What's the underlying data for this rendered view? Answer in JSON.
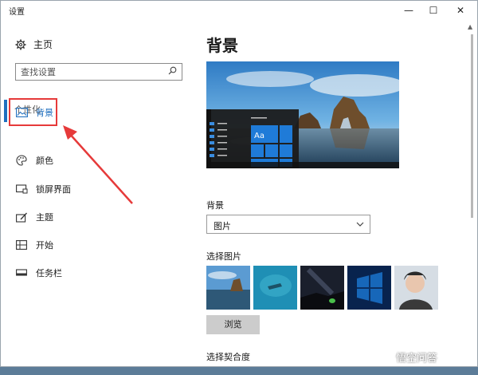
{
  "window": {
    "title": "设置"
  },
  "titlebar_buttons": {
    "minimize": "—",
    "maximize": "☐",
    "close": "✕"
  },
  "sidebar": {
    "home_label": "主页",
    "search_placeholder": "查找设置",
    "section_title": "个性化",
    "items": [
      {
        "label": "背景",
        "icon": "picture-icon",
        "active": true
      },
      {
        "label": "颜色",
        "icon": "palette-icon",
        "active": false
      },
      {
        "label": "锁屏界面",
        "icon": "lock-screen-icon",
        "active": false
      },
      {
        "label": "主题",
        "icon": "theme-icon",
        "active": false
      },
      {
        "label": "开始",
        "icon": "start-icon",
        "active": false
      },
      {
        "label": "任务栏",
        "icon": "taskbar-icon",
        "active": false
      }
    ]
  },
  "main": {
    "title": "背景",
    "preview_sample_text": "Aa",
    "background_label": "背景",
    "background_value": "图片",
    "choose_picture_label": "选择图片",
    "browse_label": "浏览",
    "fit_label": "选择契合度"
  },
  "watermark": "悟空问答",
  "colors": {
    "accent": "#1f6fbf",
    "annotation": "#e63a3a"
  }
}
